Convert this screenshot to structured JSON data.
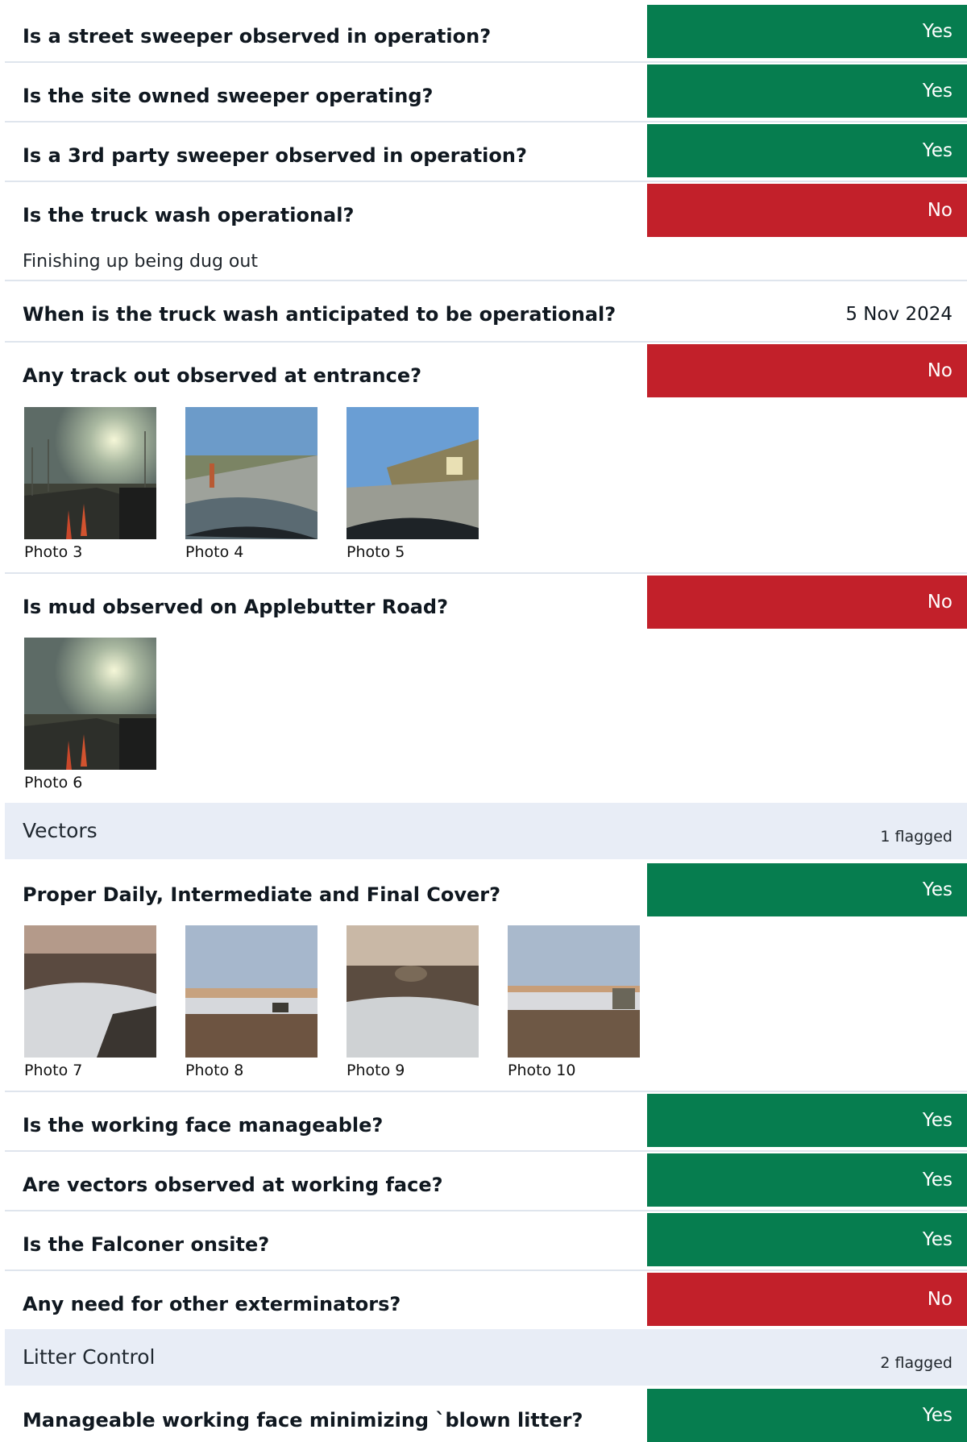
{
  "section_vectors": {
    "title": "Vectors",
    "flagged": "1 flagged"
  },
  "section_litter": {
    "title": "Litter Control",
    "flagged": "2 flagged"
  },
  "rows": [
    {
      "question": "Is a street sweeper observed in operation?",
      "answer": "Yes",
      "status": "yes"
    },
    {
      "question": "Is the site owned sweeper operating?",
      "answer": "Yes",
      "status": "yes"
    },
    {
      "question": "Is a 3rd party sweeper observed in operation?",
      "answer": "Yes",
      "status": "yes"
    },
    {
      "question": "Is the truck wash operational?",
      "answer": "No",
      "status": "no",
      "note": "Finishing up being dug out"
    },
    {
      "question": "When is the truck wash anticipated to be operational?",
      "answer": "5 Nov 2024",
      "status": "date"
    },
    {
      "question": "Any track out observed at entrance?",
      "answer": "No",
      "status": "no",
      "photos": [
        "Photo 3",
        "Photo 4",
        "Photo 5"
      ]
    },
    {
      "question": "Is mud observed on Applebutter Road?",
      "answer": "No",
      "status": "no",
      "photos": [
        "Photo 6"
      ]
    },
    {
      "question": "Proper Daily, Intermediate and Final Cover?",
      "answer": "Yes",
      "status": "yes",
      "photos": [
        "Photo 7",
        "Photo 8",
        "Photo 9",
        "Photo 10"
      ]
    },
    {
      "question": "Is the working face manageable?",
      "answer": "Yes",
      "status": "yes"
    },
    {
      "question": "Are vectors observed at working face?",
      "answer": "Yes",
      "status": "yes"
    },
    {
      "question": "Is the Falconer onsite?",
      "answer": "Yes",
      "status": "yes"
    },
    {
      "question": "Any need for other exterminators?",
      "answer": "No",
      "status": "no"
    },
    {
      "question": "Manageable working face minimizing `blown litter?",
      "answer": "Yes",
      "status": "yes"
    }
  ],
  "colors": {
    "yes": "#067d4f",
    "no": "#c2202a",
    "section_bg": "#e8edf6",
    "divider": "#dfe5ed"
  }
}
